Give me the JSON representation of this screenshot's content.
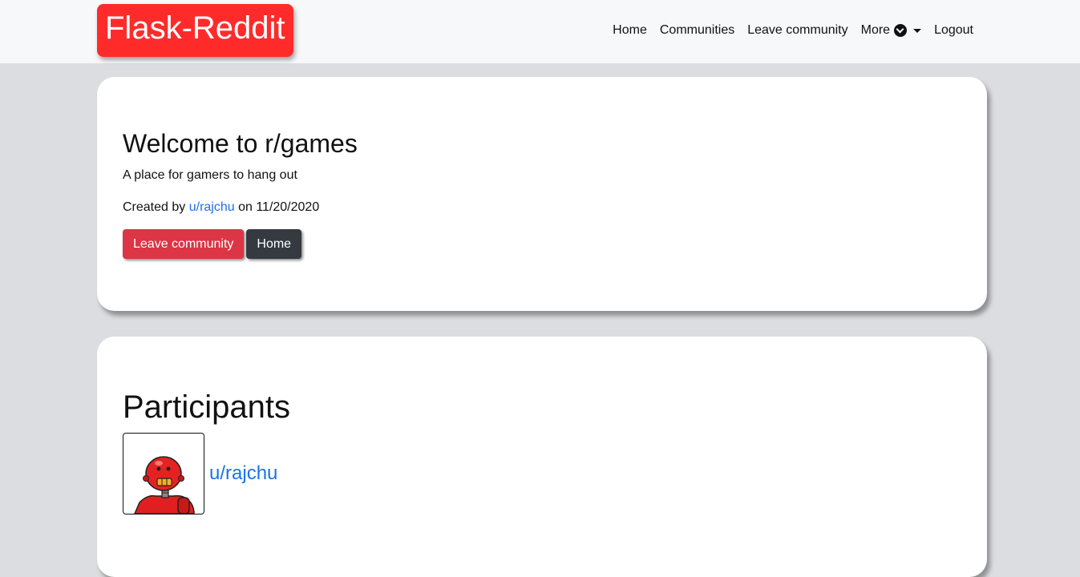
{
  "brand": "Flask-Reddit",
  "nav": {
    "home": "Home",
    "communities": "Communities",
    "leave": "Leave community",
    "more": "More",
    "logout": "Logout"
  },
  "community": {
    "title": "Welcome to r/games",
    "description": "A place for gamers to hang out",
    "created_prefix": "Created by ",
    "creator": "u/rajchu",
    "created_suffix": " on 11/20/2020",
    "leave_button": "Leave community",
    "home_button": "Home"
  },
  "participants": {
    "heading": "Participants",
    "list": [
      {
        "name": "u/rajchu",
        "avatar_icon": "red-robot-avatar-icon"
      }
    ]
  },
  "colors": {
    "brand": "#ff2b2b",
    "link": "#1a73e8",
    "danger": "#dc3545",
    "dark": "#343a40",
    "background": "#dcdde0"
  }
}
